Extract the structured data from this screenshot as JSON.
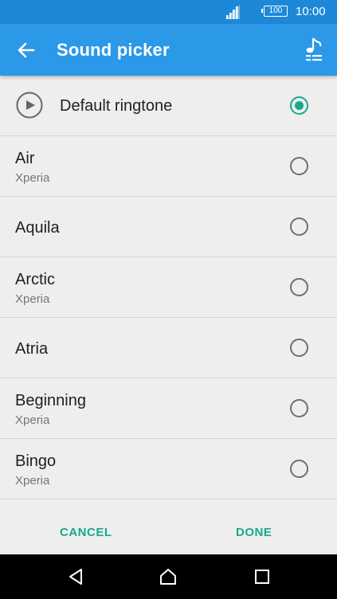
{
  "status_bar": {
    "battery": "100",
    "time": "10:00"
  },
  "app_bar": {
    "title": "Sound picker"
  },
  "default_item": {
    "label": "Default ringtone",
    "selected": true
  },
  "items": [
    {
      "name": "Air",
      "subtitle": "Xperia"
    },
    {
      "name": "Aquila",
      "subtitle": ""
    },
    {
      "name": "Arctic",
      "subtitle": "Xperia"
    },
    {
      "name": "Atria",
      "subtitle": ""
    },
    {
      "name": "Beginning",
      "subtitle": "Xperia"
    },
    {
      "name": "Bingo",
      "subtitle": "Xperia"
    }
  ],
  "footer": {
    "cancel_label": "CANCEL",
    "done_label": "DONE"
  },
  "colors": {
    "app_bar": "#2b98e8",
    "status_bar": "#1e88d8",
    "accent": "#17a88b"
  },
  "icons": {
    "back": "arrow-left-icon",
    "music": "music-note-list-icon",
    "play": "play-circle-icon",
    "nav_back": "triangle-back-icon",
    "nav_home": "home-icon",
    "nav_recents": "square-recents-icon"
  }
}
